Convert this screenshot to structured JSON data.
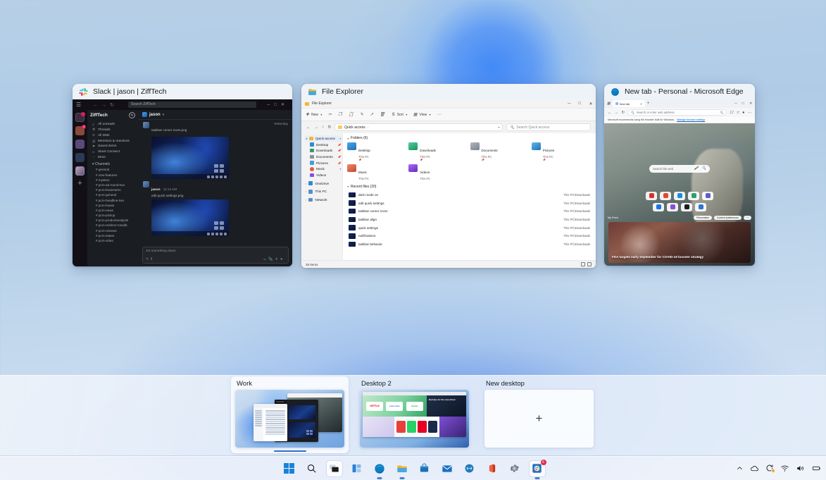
{
  "screen": {
    "view": "Task View",
    "wallpaper": "windows-11-bloom-blue"
  },
  "windows": [
    {
      "title": "Slack | jason | ZiffTech",
      "icon": "slack-icon",
      "app": "slack",
      "search_placeholder": "Search ZiffTech",
      "workspace": "ZiffTech",
      "nav_items": [
        {
          "label": "All unreads",
          "glyph": "≡"
        },
        {
          "label": "Threads",
          "glyph": "⌘"
        },
        {
          "label": "All DMs",
          "glyph": "✉"
        },
        {
          "label": "Mentions & reactions",
          "glyph": "@"
        },
        {
          "label": "Saved items",
          "glyph": "⚑"
        },
        {
          "label": "Slack Connect",
          "glyph": "∞"
        },
        {
          "label": "More",
          "glyph": "⋯"
        }
      ],
      "section_label": "Channels",
      "channels": [
        "general",
        "new-features",
        "mystine",
        "pcm-ad-round-two",
        "pcm-brainstorm",
        "pcm-general",
        "pcm-headline-two",
        "pcm-howto",
        "pcm-news",
        "pcm-pickup",
        "pcm-productanalysts",
        "pcm-redirect-rossdb",
        "pcm-reviews",
        "pcm-states",
        "pcm-video"
      ],
      "conversation": "jason",
      "messages": [
        {
          "author": "jason",
          "file": "taskbar corner icons.png",
          "time": "Yesterday"
        },
        {
          "author": "jason",
          "file": "edit quick settings.png",
          "time": "11:14 AM"
        }
      ],
      "composer_placeholder": "Jot something down"
    },
    {
      "title": "File Explorer",
      "icon": "folder-icon",
      "app": "file-explorer",
      "tab_title": "File Explorer",
      "new_label": "New",
      "sort_label": "Sort",
      "view_label": "View",
      "path": "Quick access",
      "search_placeholder": "Search Quick access",
      "sidebar": [
        {
          "label": "Quick access",
          "color": "#f5b731",
          "selected": true
        },
        {
          "label": "Desktop",
          "color": "#2f8ad8",
          "pinned": true
        },
        {
          "label": "Downloads",
          "color": "#2f9e6f",
          "pinned": true
        },
        {
          "label": "Documents",
          "color": "#8a9099",
          "pinned": true
        },
        {
          "label": "Pictures",
          "color": "#3f9fe0",
          "pinned": true
        },
        {
          "label": "Music",
          "color": "#e0603f",
          "pinned": false
        },
        {
          "label": "Videos",
          "color": "#8a4fd8",
          "pinned": false
        },
        {
          "label": "OneDrive",
          "color": "#2f8ad8",
          "pinned": false
        },
        {
          "label": "This PC",
          "color": "#5a8fc4",
          "pinned": false
        },
        {
          "label": "Network",
          "color": "#5a8fc4",
          "pinned": false
        }
      ],
      "folders_group": "Folders (6)",
      "folders": [
        {
          "name": "Desktop",
          "location": "This PC",
          "color": "#1f8ad8"
        },
        {
          "name": "Downloads",
          "location": "This PC",
          "color": "#1f9e6f"
        },
        {
          "name": "Documents",
          "location": "This PC",
          "color": "#8a9099"
        },
        {
          "name": "Pictures",
          "location": "This PC",
          "color": "#2f8fd8"
        },
        {
          "name": "Music",
          "location": "This PC",
          "color": "#e0603f"
        },
        {
          "name": "Videos",
          "location": "This PC",
          "color": "#8a4fd8"
        }
      ],
      "recent_group": "Recent files (20)",
      "recent_files": [
        {
          "name": "dark mode on",
          "location": "This PC\\Downloads"
        },
        {
          "name": "edit quick settings",
          "location": "This PC\\Downloads"
        },
        {
          "name": "taskbar corner icons",
          "location": "This PC\\Downloads"
        },
        {
          "name": "taskbar align",
          "location": "This PC\\Downloads"
        },
        {
          "name": "quick settings",
          "location": "This PC\\Downloads"
        },
        {
          "name": "notifications",
          "location": "This PC\\Downloads"
        },
        {
          "name": "taskbar behavior",
          "location": "This PC\\Downloads"
        }
      ],
      "status": "26 items"
    },
    {
      "title": "New tab - Personal - Microsoft Edge",
      "icon": "edge-icon",
      "app": "edge",
      "tab_label": "New tab",
      "omnibox_placeholder": "Search or enter web address",
      "notice_text": "Microsoft recommends using the browser built for Windows.",
      "notice_link": "Manage browser settings",
      "page_search_placeholder": "Search the web",
      "news_feed_label": "My Feed",
      "news_pills": [
        "Personalize",
        "Content preferences"
      ],
      "news_headline": "FDA targets early September for COVID-19 booster strategy"
    }
  ],
  "desktops": [
    {
      "name": "Work",
      "active": true
    },
    {
      "name": "Desktop 2",
      "active": false
    },
    {
      "name": "New desktop",
      "active": false,
      "is_new": true,
      "glyph": "+"
    }
  ],
  "desktop2_thumb": {
    "tiles": [
      "NETFLIX",
      "prime video",
      "Spotify"
    ],
    "headline": "Dad tips for the new driver"
  },
  "taskbar": {
    "items": [
      {
        "name": "start",
        "label": "Start",
        "icon": "windows-logo-icon"
      },
      {
        "name": "search",
        "label": "Search",
        "icon": "search-icon"
      },
      {
        "name": "task-view",
        "label": "Task View",
        "icon": "task-view-icon",
        "active": true
      },
      {
        "name": "widgets",
        "label": "Widgets",
        "icon": "widgets-icon"
      },
      {
        "name": "edge",
        "label": "Microsoft Edge",
        "icon": "edge-icon",
        "running": true
      },
      {
        "name": "file-explorer",
        "label": "File Explorer",
        "icon": "folder-icon",
        "running": true
      },
      {
        "name": "store",
        "label": "Microsoft Store",
        "icon": "store-icon"
      },
      {
        "name": "mail",
        "label": "Mail",
        "icon": "mail-icon"
      },
      {
        "name": "teams",
        "label": "Chat",
        "icon": "chat-icon"
      },
      {
        "name": "office",
        "label": "Office",
        "icon": "office-icon"
      },
      {
        "name": "settings",
        "label": "Settings",
        "icon": "gear-icon"
      },
      {
        "name": "slack",
        "label": "Slack",
        "icon": "slack-icon",
        "running": true,
        "active": true,
        "badge": "6"
      }
    ],
    "tray": [
      {
        "name": "show-hidden-icons",
        "icon": "chevron-up-icon"
      },
      {
        "name": "onedrive",
        "icon": "cloud-icon"
      },
      {
        "name": "update-available",
        "icon": "sync-icon",
        "badge": true
      },
      {
        "name": "network",
        "icon": "wifi-icon"
      },
      {
        "name": "volume",
        "icon": "speaker-icon"
      },
      {
        "name": "battery",
        "icon": "battery-icon"
      }
    ]
  },
  "colors": {
    "accent": "#2f6fd0",
    "badge": "#e3274d",
    "slack_bg": "#1a1d21",
    "panel": "#eef3f8"
  }
}
